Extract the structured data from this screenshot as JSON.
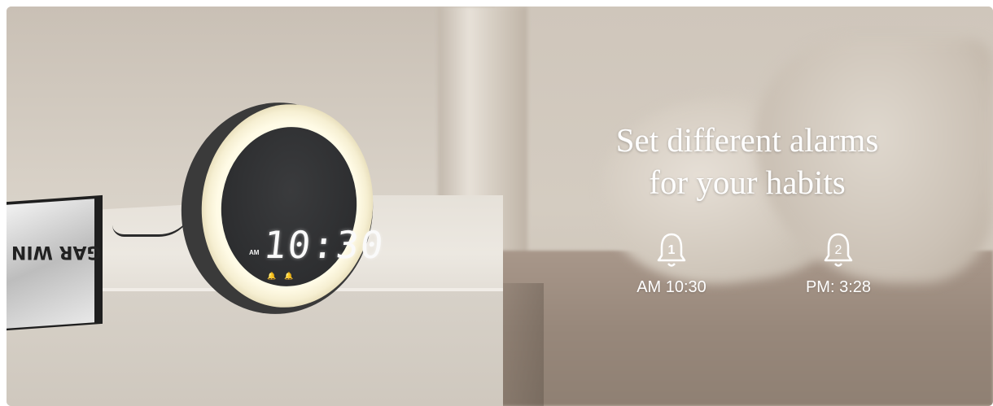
{
  "banner": {
    "headline_line1": "Set different alarms",
    "headline_line2": "for your habits",
    "alarms": [
      {
        "number": "1",
        "label": "AM 10:30",
        "icon": "bell-icon"
      },
      {
        "number": "2",
        "label": "PM: 3:28",
        "icon": "bell-icon"
      }
    ]
  },
  "clock": {
    "meridiem": "AM",
    "time": "10:30"
  },
  "book": {
    "text": "GAR WIN"
  },
  "colors": {
    "text": "#ffffff",
    "clock_body": "#3a3a3a",
    "ring_light": "#fffbe6",
    "bed": "#98887b"
  }
}
